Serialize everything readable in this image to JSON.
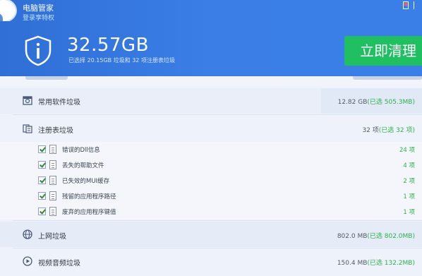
{
  "header": {
    "app_title": "电脑管家",
    "login_link": "登录享特权",
    "total_size": "32.57GB",
    "summary": "已选择 20.15GB 垃圾和 32 项注册表垃圾",
    "clean_button": "立即清理"
  },
  "colors": {
    "header_blue": "#3a7ee6",
    "accent_green": "#1fbf62",
    "selected_green": "#2db14b"
  },
  "icons": {
    "shield": "shield-info-icon",
    "software": "software-box-icon",
    "registry": "registry-icon",
    "web": "globe-icon",
    "media": "play-circle-icon",
    "doc": "document-icon"
  },
  "categories": [
    {
      "label": "常用软件垃圾",
      "size": "12.82 GB",
      "selected_prefix": "(已选 ",
      "selected": "505.3MB",
      "selected_suffix": ")"
    },
    {
      "label": "注册表垃圾",
      "size": "32 项",
      "selected_prefix": "(已选 ",
      "selected": "32 项",
      "selected_suffix": ")"
    },
    {
      "label": "上网垃圾",
      "size": "802.0 MB",
      "selected_prefix": "(已选 ",
      "selected": "802.0MB",
      "selected_suffix": ")"
    },
    {
      "label": "视频音频垃圾",
      "size": "150.4 MB",
      "selected_prefix": "(已选 ",
      "selected": "132.2MB",
      "selected_suffix": ")"
    }
  ],
  "registry_items": [
    {
      "label": "错误的Dll信息",
      "count": "24 项",
      "checked": true
    },
    {
      "label": "丢失的帮助文件",
      "count": "4 项",
      "checked": true
    },
    {
      "label": "已失效的MUI缓存",
      "count": "2 项",
      "checked": true
    },
    {
      "label": "残留的应用程序路径",
      "count": "1 项",
      "checked": true
    },
    {
      "label": "废弃的应用程序键值",
      "count": "1 项",
      "checked": true
    }
  ]
}
